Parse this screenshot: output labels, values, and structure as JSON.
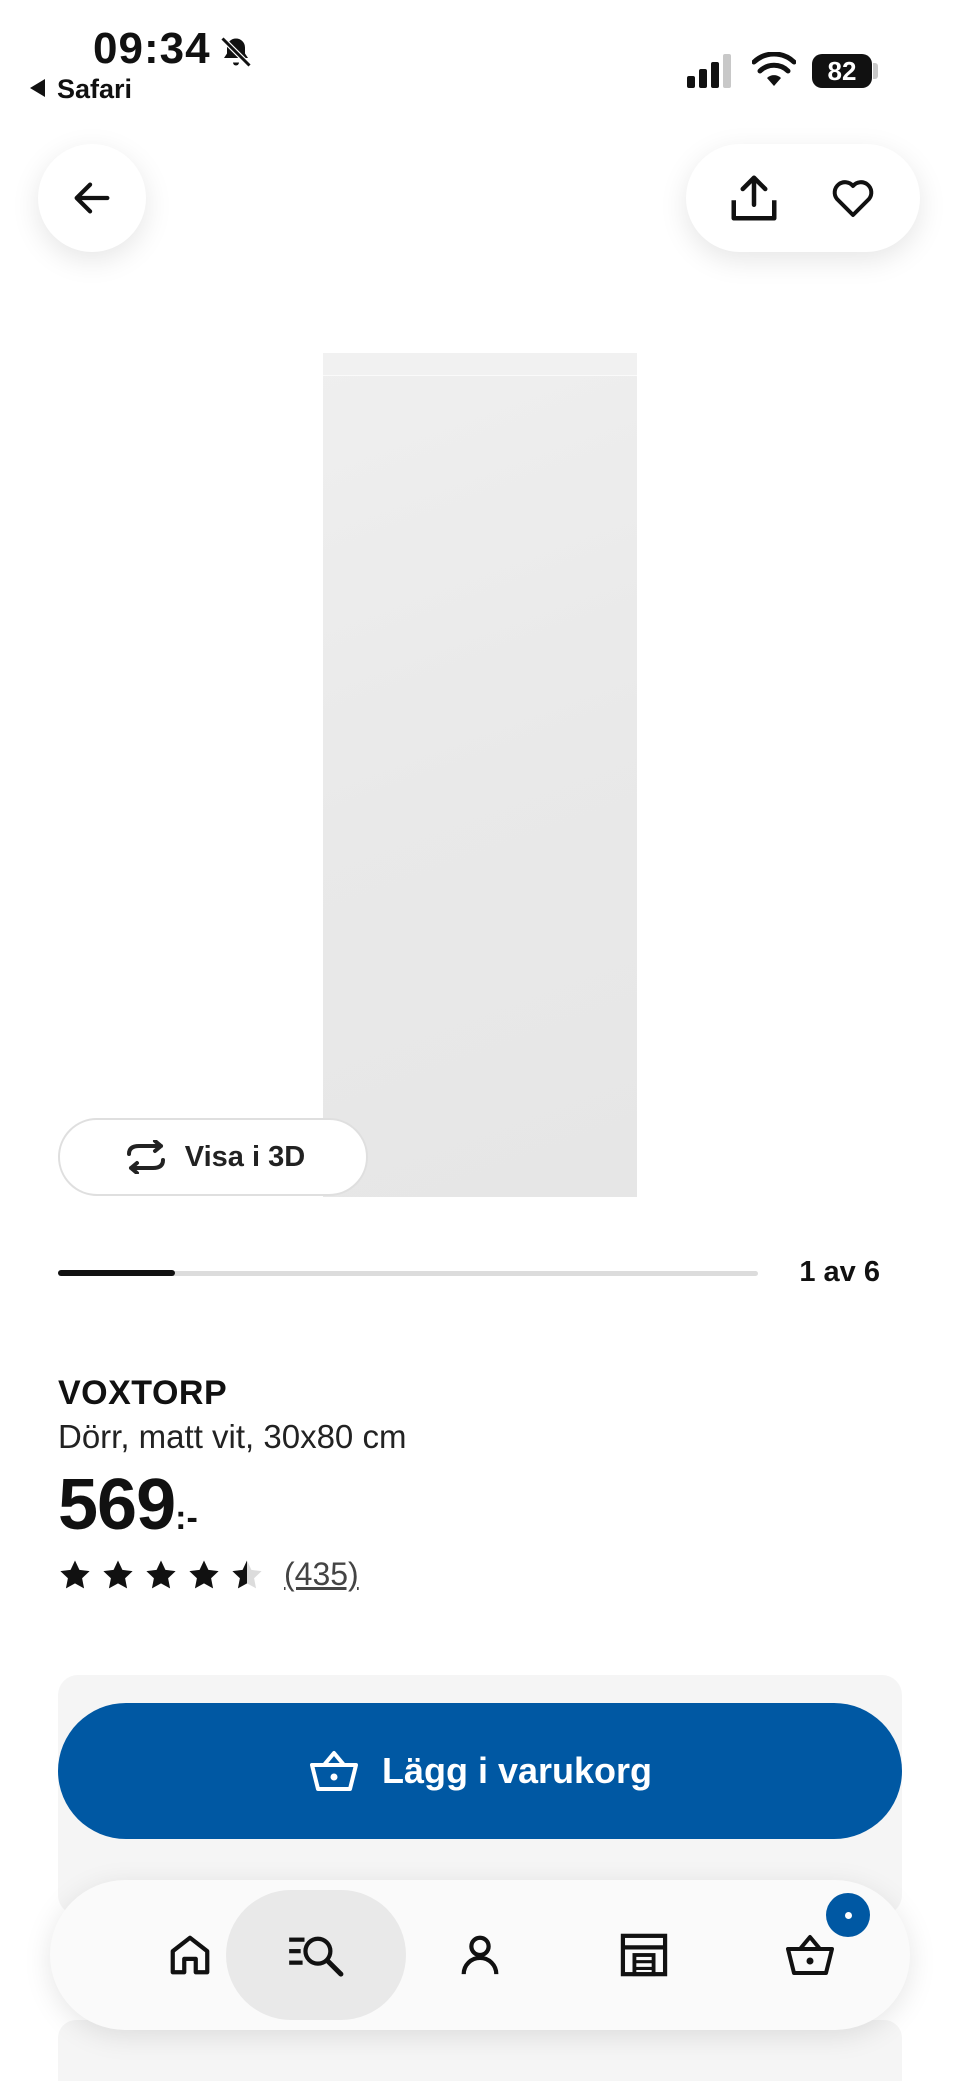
{
  "status_bar": {
    "time": "09:34",
    "back_app": "Safari",
    "battery": "82",
    "icons": [
      "bell-slash-icon",
      "signal-icon",
      "wifi-icon",
      "battery-icon"
    ]
  },
  "top_actions": {
    "back_icon": "arrow-left-icon",
    "share_icon": "share-icon",
    "favorite_icon": "heart-icon"
  },
  "gallery": {
    "view_3d_label": "Visa i 3D",
    "counter": "1 av 6",
    "current": 1,
    "total": 6
  },
  "product": {
    "name": "VOXTORP",
    "description": "Dörr, matt vit, 30x80 cm",
    "price": "569",
    "price_suffix": ":-",
    "rating": 4.5,
    "review_count": "(435)"
  },
  "cart": {
    "add_label": "Lägg i varukorg"
  },
  "bottom_nav": {
    "items": [
      {
        "icon": "home-icon",
        "active": false
      },
      {
        "icon": "search-menu-icon",
        "active": true
      },
      {
        "icon": "user-icon",
        "active": false
      },
      {
        "icon": "store-icon",
        "active": false
      },
      {
        "icon": "basket-icon",
        "active": false
      }
    ]
  },
  "colors": {
    "accent": "#0058a3",
    "text": "#111111",
    "panel": "#f5f5f5"
  }
}
